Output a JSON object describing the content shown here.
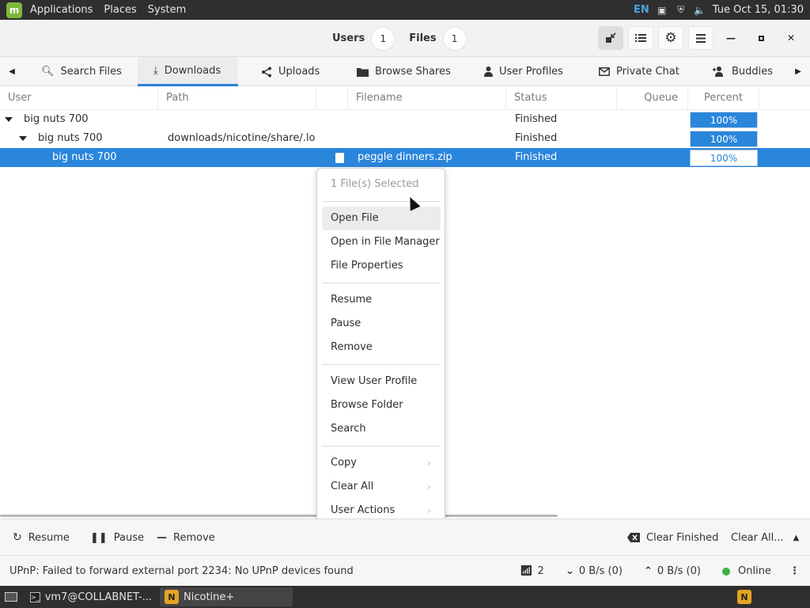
{
  "system_panel": {
    "menus": [
      "Applications",
      "Places",
      "System"
    ],
    "language": "EN",
    "clock": "Tue Oct 15, 01:30"
  },
  "header": {
    "users_label": "Users",
    "users_count": "1",
    "files_label": "Files",
    "files_count": "1"
  },
  "tabs": [
    {
      "label": "Search Files",
      "icon": "search-icon"
    },
    {
      "label": "Downloads",
      "icon": "download-icon"
    },
    {
      "label": "Uploads",
      "icon": "share-icon"
    },
    {
      "label": "Browse Shares",
      "icon": "folder-icon"
    },
    {
      "label": "User Profiles",
      "icon": "user-icon"
    },
    {
      "label": "Private Chat",
      "icon": "mail-icon"
    },
    {
      "label": "Buddies",
      "icon": "add-user-icon"
    }
  ],
  "table": {
    "columns": [
      "User",
      "Path",
      "Filename",
      "Status",
      "Queue",
      "Percent"
    ],
    "rows": [
      {
        "user": "big nuts 700",
        "path": "",
        "filename": "",
        "status": "Finished",
        "percent": "100%",
        "percent_value": 1.0
      },
      {
        "user": "big nuts 700",
        "path": "downloads/nicotine/share/.loca",
        "filename": "",
        "status": "Finished",
        "percent": "100%",
        "percent_value": 1.0
      },
      {
        "user": "big nuts 700",
        "path": "",
        "filename": "peggle dinners.zip",
        "status": "Finished",
        "percent": "100%",
        "percent_value": 1.0
      }
    ]
  },
  "context_menu": {
    "header": "1 File(s) Selected",
    "open_file": "Open File",
    "open_in_manager": "Open in File Manager",
    "file_properties": "File Properties",
    "resume": "Resume",
    "pause": "Pause",
    "remove": "Remove",
    "view_profile": "View User Profile",
    "browse_folder": "Browse Folder",
    "search": "Search",
    "copy": "Copy",
    "clear_all": "Clear All",
    "user_actions": "User Actions"
  },
  "actions": {
    "resume": "Resume",
    "pause": "Pause",
    "remove": "Remove",
    "clear_finished": "Clear Finished",
    "clear_all": "Clear All..."
  },
  "status": {
    "message": "UPnP: Failed to forward external port 2234: No UPnP devices found",
    "connections": "2",
    "download_speed": "0 B/s (0)",
    "upload_speed": "0 B/s (0)",
    "online": "Online"
  },
  "taskbar": {
    "terminal": "vm7@COLLABNET-...",
    "app": "Nicotine+"
  },
  "colors": {
    "accent": "#2a86db",
    "online": "#3cb043",
    "panel": "#2f2f2f"
  }
}
